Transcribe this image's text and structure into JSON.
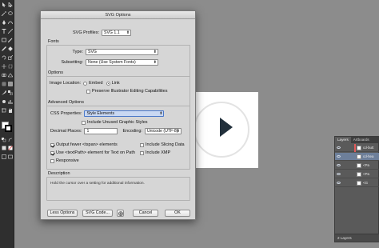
{
  "dialog": {
    "title": "SVG Options",
    "svg_profiles_label": "SVG Profiles:",
    "svg_profiles_value": "SVG 1.1",
    "fonts_group": "Fonts",
    "type_label": "Type:",
    "type_value": "SVG",
    "subsetting_label": "Subsetting:",
    "subsetting_value": "None (Use System Fonts)",
    "options_group": "Options",
    "image_location_label": "Image Location:",
    "embed_label": "Embed",
    "link_label": "Link",
    "image_location_selected": "link",
    "preserve_label": "Preserve Illustrator Editing Capabilities",
    "advanced_group": "Advanced Options",
    "css_properties_label": "CSS Properties:",
    "css_properties_value": "Style Elements",
    "include_unused_label": "Include Unused Graphic Styles",
    "decimal_places_label": "Decimal Places:",
    "decimal_places_value": "1",
    "encoding_label": "Encoding:",
    "encoding_value": "Unicode (UTF-8)",
    "output_fewer_label": "Output fewer <tspan> elements",
    "use_textpath_label": "Use <textPath> element for Text on Path",
    "responsive_label": "Responsive",
    "include_slicing_label": "Include Slicing Data",
    "include_xmp_label": "Include XMP",
    "output_fewer_checked": true,
    "use_textpath_checked": true,
    "responsive_checked": false,
    "include_slicing_checked": false,
    "include_xmp_checked": false,
    "preserve_checked": false,
    "include_unused_checked": false,
    "description_group": "Description",
    "description_text": "Hold the cursor over a setting for additional information.",
    "less_options_button": "Less Options",
    "svg_code_button": "SVG Code...",
    "cancel_button": "Cancel",
    "ok_button": "OK"
  },
  "layers_panel": {
    "tabs": [
      "Layers",
      "Artboards"
    ],
    "rows": [
      {
        "name": "cd-butt"
      },
      {
        "name": "cd-hea"
      },
      {
        "name": "<Pa"
      },
      {
        "name": "<Pa"
      },
      {
        "name": "<G"
      }
    ],
    "footer": "2 Layers"
  },
  "colors": {
    "dialog_bg": "#d6d6d6",
    "workspace_bg": "#8c8c8c",
    "play_icon": "#22303c",
    "highlight_select": "#c9d8f2",
    "layer_selected": "#6d7f9a"
  }
}
